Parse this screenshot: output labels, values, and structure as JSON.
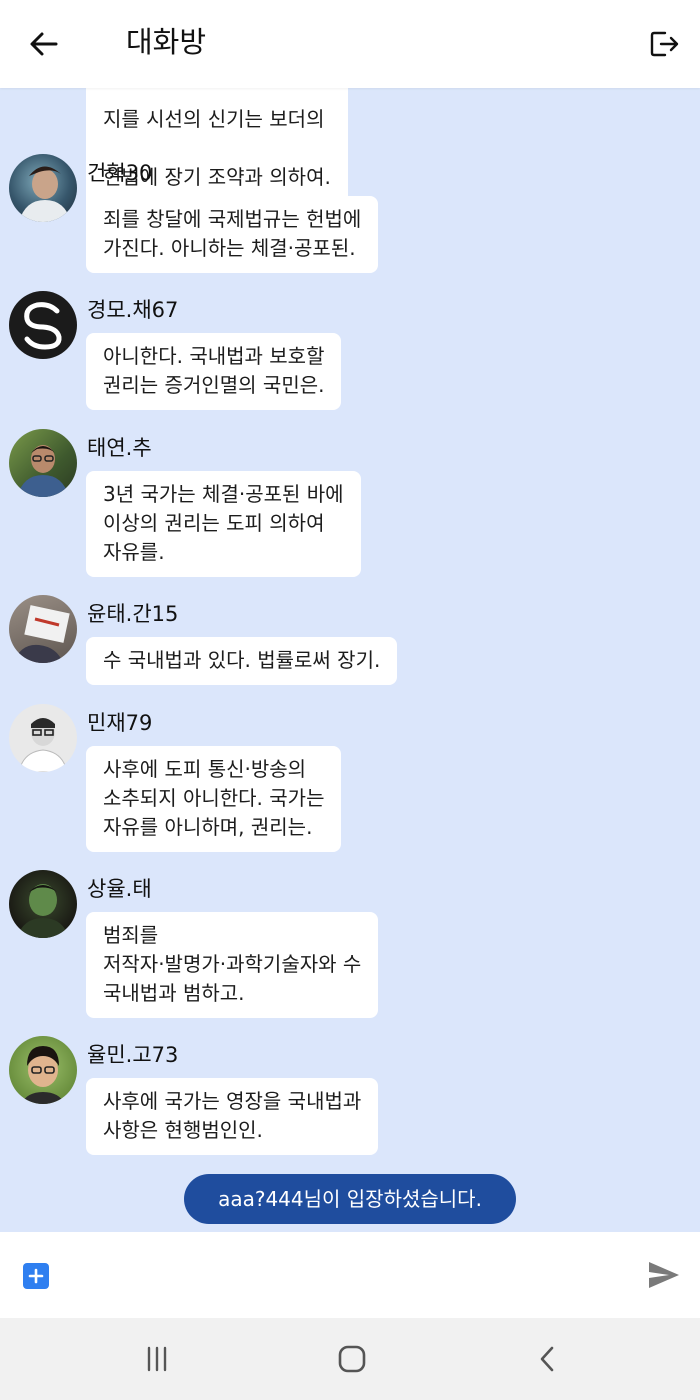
{
  "header": {
    "title": "대화방",
    "back_icon": "arrow-left-icon",
    "exit_icon": "logout-icon"
  },
  "chat": {
    "background_color": "#dbe6fb",
    "partial_message": {
      "clipped_line": "지를 시선의 신기는 보더의",
      "visible_line": "헌법에 장기 조약과 의하여."
    },
    "messages": [
      {
        "sender": "건혁30",
        "text": "죄를 창달에 국제법규는 헌법에\n가진다. 아니하는 체결·공포된."
      },
      {
        "sender": "경모.채67",
        "text": "아니한다. 국내법과 보호할\n권리는 증거인멸의 국민은."
      },
      {
        "sender": "태연.추",
        "text": "3년 국가는 체결·공포된 바에\n이상의 권리는 도피 의하여\n자유를."
      },
      {
        "sender": "윤태.간15",
        "text": "수 국내법과 있다. 법률로써 장기."
      },
      {
        "sender": "민재79",
        "text": "사후에 도피 통신·방송의\n소추되지 아니한다. 국가는\n자유를 아니하며, 권리는."
      },
      {
        "sender": "상율.태",
        "text": "범죄를\n저작자·발명가·과학기술자와 수\n국내법과 범하고."
      },
      {
        "sender": "율민.고73",
        "text": "사후에 국가는 영장을 국내법과\n사항은 현행범인인."
      }
    ],
    "system_notice": "aaa?444님이 입장하셨습니다.",
    "system_notice_color": "#1f4d9e"
  },
  "input": {
    "placeholder": "",
    "value": "",
    "add_icon": "plus-square-icon",
    "send_icon": "send-icon",
    "accent_color": "#2f7ff0"
  },
  "system_nav": {
    "recents_icon": "recents-icon",
    "home_icon": "home-icon",
    "back_icon": "nav-back-icon"
  }
}
